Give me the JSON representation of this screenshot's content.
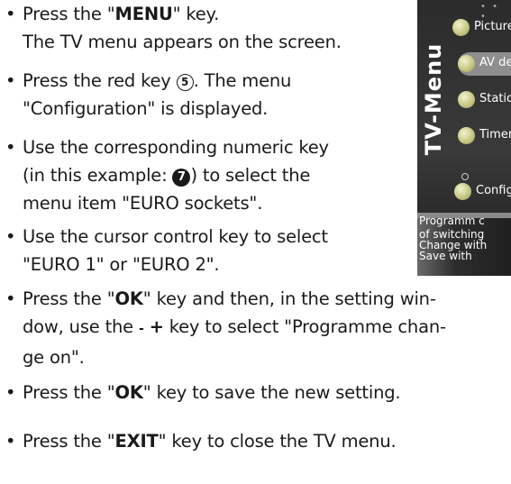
{
  "steps": [
    {
      "pre": "Press the \"",
      "key": "MENU",
      "post": "\" key.",
      "line2": "The TV menu appears on the screen."
    },
    {
      "a": "Press the red key ",
      "key_glyph": "5",
      "b": ". The menu",
      "line2": "\"Configuration\" is displayed."
    },
    {
      "line1": "Use the corresponding numeric key",
      "l2a": "(in this example: ",
      "key_glyph": "7",
      "l2b": ") to select the",
      "line3": "menu item \"EURO sockets\"."
    },
    {
      "line1": "Use the cursor control key to select",
      "line2": "\"EURO 1\" or \"EURO 2\"."
    },
    {
      "pre": "Press the \"",
      "key": "OK",
      "mid": "\" key and then, in the setting win-",
      "line2_pre": "dow, use the ",
      "minus": "-",
      "plus": "+",
      "line2_post": " key to select \"Programme chan-",
      "line3": "ge on\"."
    },
    {
      "pre": "Press the \"",
      "key": "OK",
      "post": "\" key to save the new setting."
    },
    {
      "pre": "Press the \"",
      "key": "EXIT",
      "post": "\" key to close the TV menu."
    }
  ],
  "bullet": "•",
  "tv_menu": {
    "vertical_title": "TV-Menu",
    "top_dots": "• • •",
    "items": [
      {
        "label": "Picture",
        "selected": false
      },
      {
        "label": "AV dev",
        "selected": true
      },
      {
        "label": "Station",
        "selected": false
      },
      {
        "label": "Timer",
        "selected": false
      },
      {
        "label": "Config",
        "selected": false
      }
    ],
    "info_lines": [
      "Programm c",
      "of switching",
      "Change with",
      "Save with"
    ]
  }
}
